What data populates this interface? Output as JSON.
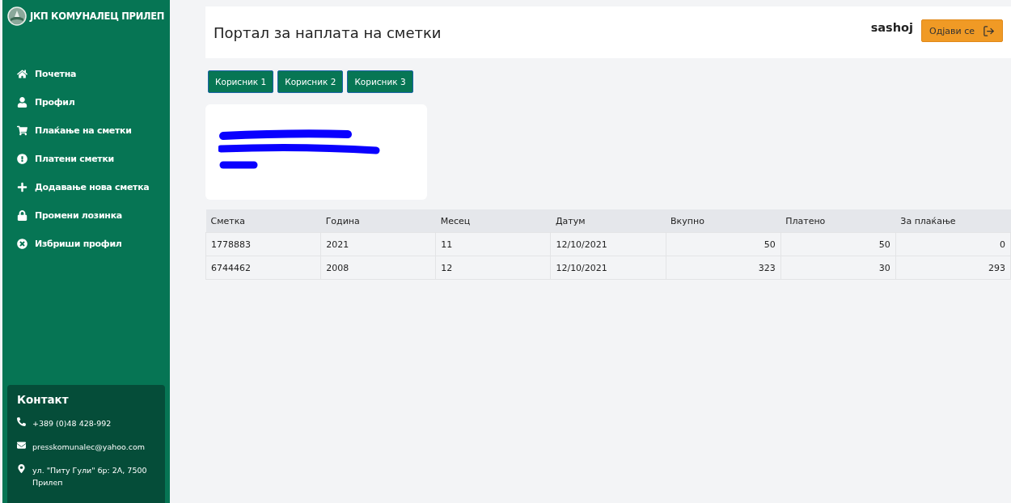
{
  "sidebar": {
    "brand": "ЈКП КОМУНАЛЕЦ ПРИЛЕП",
    "items": [
      {
        "label": "Почетна"
      },
      {
        "label": "Профил"
      },
      {
        "label": "Плаќање на сметки"
      },
      {
        "label": "Платени сметки"
      },
      {
        "label": "Додавање нова сметка"
      },
      {
        "label": "Промени лозинка"
      },
      {
        "label": "Избриши профил"
      }
    ],
    "contact": {
      "title": "Контакт",
      "lines": [
        "+389 (0)48 428-992",
        "presskomunalec@yahoo.com",
        "ул. \"Питу Гули\" бр: 2А, 7500 Прилеп"
      ]
    }
  },
  "header": {
    "title": "Портал за наплата на сметки",
    "user": "sashoj",
    "logout": "Одјави се"
  },
  "users": [
    "Корисник 1",
    "Корисник 2",
    "Корисник 3"
  ],
  "table": {
    "columns": [
      "Сметка",
      "Година",
      "Месец",
      "Датум",
      "Вкупно",
      "Платено",
      "За плаќање"
    ],
    "rows": [
      [
        "1778883",
        "2021",
        "11",
        "12/10/2021",
        "50",
        "50",
        "0"
      ],
      [
        "6744462",
        "2008",
        "12",
        "12/10/2021",
        "323",
        "30",
        "293"
      ]
    ]
  }
}
